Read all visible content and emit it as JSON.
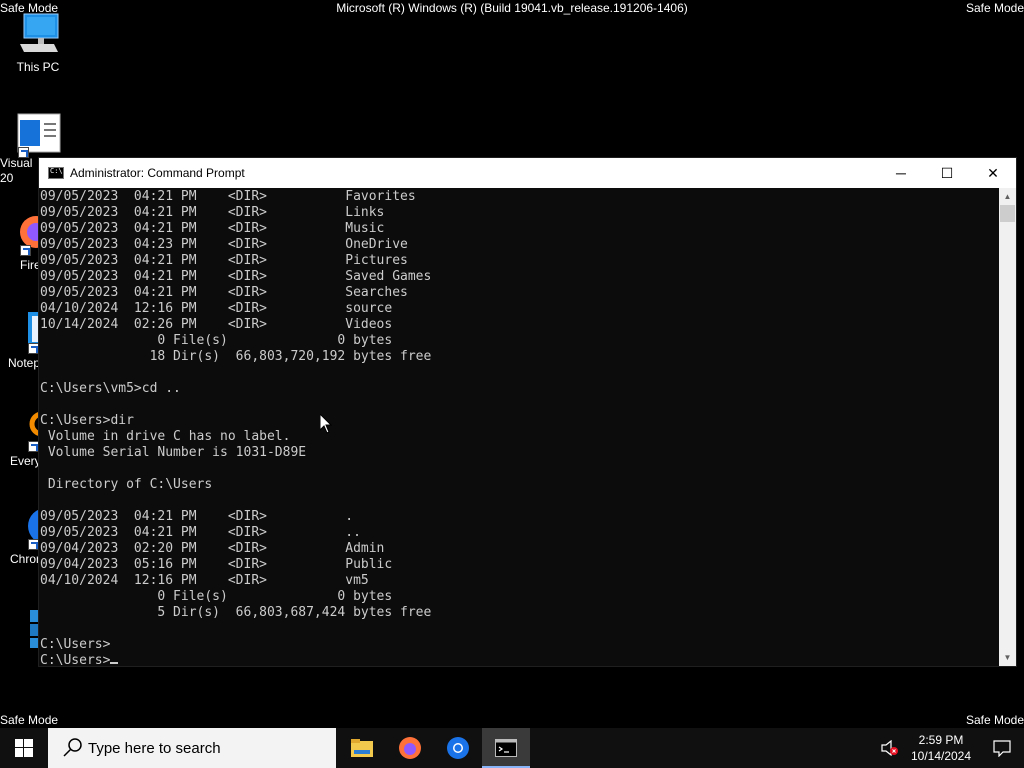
{
  "desktop": {
    "safe_mode_label": "Safe Mode",
    "build_text": "Microsoft (R) Windows (R) (Build 19041.vb_release.191206-1406)",
    "icons": [
      {
        "label": "This PC",
        "icon": "computer-icon"
      },
      {
        "label": "Visual\n20",
        "icon": "visual-studio-icon"
      },
      {
        "label": "Fire",
        "icon": "firefox-icon"
      },
      {
        "label": "Notep",
        "icon": "notepad-icon"
      },
      {
        "label": "Every",
        "icon": "everything-icon"
      },
      {
        "label": "Chrom",
        "icon": "chrome-icon"
      },
      {
        "label": "",
        "icon": "app-cubes-icon"
      }
    ]
  },
  "window": {
    "title": "Administrator: Command Prompt",
    "minimize_label": "─",
    "maximize_label": "☐",
    "close_label": "✕",
    "lines": [
      "09/05/2023  04:21 PM    <DIR>          Favorites",
      "09/05/2023  04:21 PM    <DIR>          Links",
      "09/05/2023  04:21 PM    <DIR>          Music",
      "09/05/2023  04:23 PM    <DIR>          OneDrive",
      "09/05/2023  04:21 PM    <DIR>          Pictures",
      "09/05/2023  04:21 PM    <DIR>          Saved Games",
      "09/05/2023  04:21 PM    <DIR>          Searches",
      "04/10/2024  12:16 PM    <DIR>          source",
      "10/14/2024  02:26 PM    <DIR>          Videos",
      "               0 File(s)              0 bytes",
      "              18 Dir(s)  66,803,720,192 bytes free",
      "",
      "C:\\Users\\vm5>cd ..",
      "",
      "C:\\Users>dir",
      " Volume in drive C has no label.",
      " Volume Serial Number is 1031-D89E",
      "",
      " Directory of C:\\Users",
      "",
      "09/05/2023  04:21 PM    <DIR>          .",
      "09/05/2023  04:21 PM    <DIR>          ..",
      "09/04/2023  02:20 PM    <DIR>          Admin",
      "09/04/2023  05:16 PM    <DIR>          Public",
      "04/10/2024  12:16 PM    <DIR>          vm5",
      "               0 File(s)              0 bytes",
      "               5 Dir(s)  66,803,687,424 bytes free",
      "",
      "C:\\Users>",
      "C:\\Users>"
    ]
  },
  "taskbar": {
    "search_placeholder": "Type here to search",
    "time": "2:59 PM",
    "date": "10/14/2024"
  },
  "colors": {
    "console_bg": "#0c0c0c",
    "console_fg": "#cccccc",
    "taskbar_bg": "#101010",
    "firefox": "#ff7139",
    "chrome": "#1a73e8"
  }
}
